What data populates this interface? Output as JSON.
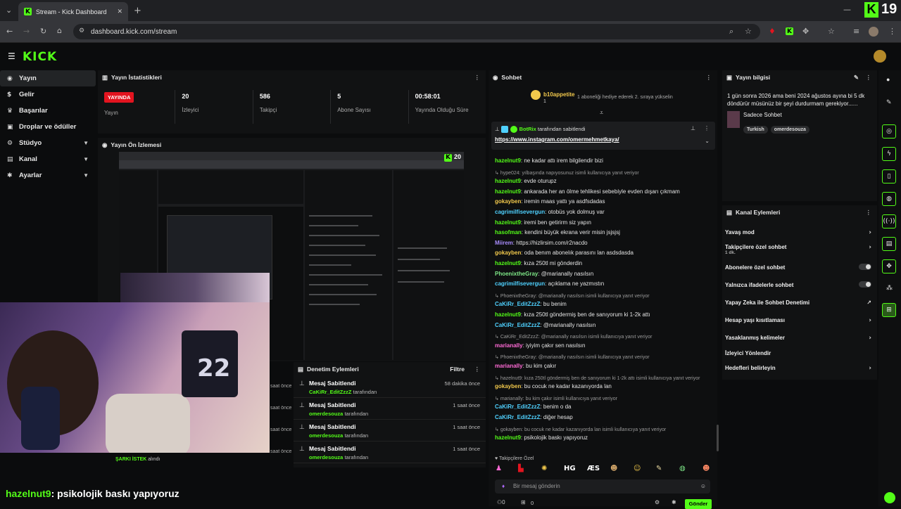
{
  "browser": {
    "tab_title": "Stream - Kick Dashboard",
    "url": "dashboard.kick.com/stream",
    "corner_number": "19"
  },
  "app": {
    "logo": "KICK"
  },
  "sidebar": {
    "items": [
      {
        "label": "Yayın",
        "icon": "broadcast-icon"
      },
      {
        "label": "Gelir",
        "icon": "dollar-icon"
      },
      {
        "label": "Başarılar",
        "icon": "trophy-icon"
      },
      {
        "label": "Droplar ve ödüller",
        "icon": "gift-icon"
      },
      {
        "label": "Stüdyo",
        "icon": "studio-icon"
      },
      {
        "label": "Kanal",
        "icon": "channel-icon"
      },
      {
        "label": "Ayarlar",
        "icon": "gear-icon"
      }
    ]
  },
  "stats": {
    "title": "Yayın İstatistikleri",
    "live_badge": "YAYINDA",
    "items": [
      {
        "value": "",
        "label": "Yayın"
      },
      {
        "value": "20",
        "label": "İzleyici"
      },
      {
        "value": "586",
        "label": "Takipçi"
      },
      {
        "value": "5",
        "label": "Abone Sayısı"
      },
      {
        "value": "00:58:01",
        "label": "Yayında Olduğu Süre"
      }
    ]
  },
  "preview": {
    "title": "Yayın Ön İzlemesi",
    "viewer_count": "20"
  },
  "overlay": {
    "subtitle_user": "hazelnut9",
    "subtitle_text": ": psikolojik baskı yapıyoruz",
    "song_request": "ŞARKI İSTEK",
    "song_request_suffix": " alındı",
    "partial_time": "saat önce"
  },
  "modlog": {
    "title": "Denetim Eylemleri",
    "filter": "Filtre",
    "items": [
      {
        "title": "Mesaj Sabitlendi",
        "user": "CaKiRr_EditZzzZ",
        "suffix": " tarafından",
        "time": "58 dakika önce"
      },
      {
        "title": "Mesaj Sabitlendi",
        "user": "omerdesouza",
        "suffix": " tarafından",
        "time": "1 saat önce"
      },
      {
        "title": "Mesaj Sabitlendi",
        "user": "omerdesouza",
        "suffix": " tarafından",
        "time": "1 saat önce"
      },
      {
        "title": "Mesaj Sabitlendi",
        "user": "omerdesouza",
        "suffix": " tarafından",
        "time": "1 saat önce"
      }
    ]
  },
  "chat": {
    "title": "Sohbet",
    "gift_user": "b10appetite",
    "gift_count": "1",
    "gift_text": "1 aboneliği hediye ederek 2. sıraya yükselin",
    "pinned_by": "BotRix",
    "pinned_suffix": " tarafından sabitlendi",
    "pinned_link": "https://www.instagram.com/omermehmetkaya/",
    "messages": [
      {
        "type": "msg",
        "user": "hazelnut9",
        "text": ": ne kadar attı irem bilgilendir bizi",
        "c": "g1"
      },
      {
        "type": "reply",
        "text": "hype024: yılbaşında napıyosunuz isimli kullanıcıya yanıt veriyor"
      },
      {
        "type": "msg",
        "user": "hazelnut9",
        "text": ": evde oturupz",
        "c": "g1"
      },
      {
        "type": "msg",
        "user": "hazelnut9",
        "text": ": ankarada her an ölme tehlikesi sebebiyle evden dışarı çıkmam",
        "c": "g1"
      },
      {
        "type": "msg",
        "user": "gokayben",
        "text": ": iremin maas yattı ya asdfsdadas",
        "c": "g3"
      },
      {
        "type": "msg",
        "user": "cagrimilfisevergun",
        "text": ": otobüs yok dolmuş var",
        "c": "g2"
      },
      {
        "type": "msg",
        "user": "hazelnut9",
        "text": ": iremi ben getirirm siz yapın",
        "c": "g1"
      },
      {
        "type": "msg",
        "user": "hasofman",
        "text": ": kendini büyük ekrana verir misin jsjsjsj",
        "c": "g1"
      },
      {
        "type": "msg",
        "user": "Miirem",
        "text": ": https://hizlirsim.com/r2nacdo",
        "c": "g6"
      },
      {
        "type": "msg",
        "user": "gokayben",
        "text": ": oda benım abonelık parasını lan asdsdasda",
        "c": "g3"
      },
      {
        "type": "msg",
        "user": "hazelnut9",
        "text": ": kıza 250tl mi gönderdin",
        "c": "g1"
      },
      {
        "type": "msg",
        "user": "PhoenixtheGray",
        "text": ": @marianally nasılsın",
        "c": "g5"
      },
      {
        "type": "msg",
        "user": "cagrimilfisevergun",
        "text": ": açıklama ne yazmıstın",
        "c": "g2"
      },
      {
        "type": "reply",
        "text": "PhoenixtheGray: @marianally nasılsın isimli kullanıcıya yanıt veriyor"
      },
      {
        "type": "msg",
        "user": "CaKiRr_EditZzzZ",
        "text": ": bu benim",
        "c": "g2"
      },
      {
        "type": "msg",
        "user": "hazelnut9",
        "text": ": kıza 250tl göndermiş ben de sanıyorum ki 1-2k attı",
        "c": "g1"
      },
      {
        "type": "msg",
        "user": "CaKiRr_EditZzzZ",
        "text": ": @marianally nasılsın",
        "c": "g2"
      },
      {
        "type": "reply",
        "text": "CaKiRr_EditZzzZ: @marianally nasılsın isimli kullanıcıya yanıt veriyor"
      },
      {
        "type": "msg",
        "user": "marianally",
        "text": ": iyiyim çakır sen nasılsın",
        "c": "g4"
      },
      {
        "type": "reply",
        "text": "PhoenixtheGray: @marianally nasılsın isimli kullanıcıya yanıt veriyor"
      },
      {
        "type": "msg",
        "user": "marianally",
        "text": ": bu kim çakır",
        "c": "g4"
      },
      {
        "type": "reply",
        "text": "hazelnut9: kıza 250tl göndermiş ben de sanıyorum ki 1-2k attı isimli kullanıcıya yanıt veriyor"
      },
      {
        "type": "msg",
        "user": "gokayben",
        "text": ": bu cocuk ne kadar kazanıyorda lan",
        "c": "g3"
      },
      {
        "type": "reply",
        "text": "marianally: bu kim çakır isimli kullanıcıya yanıt veriyor"
      },
      {
        "type": "msg",
        "user": "CaKiRr_EditZzzZ",
        "text": ": benim o da",
        "c": "g2"
      },
      {
        "type": "msg",
        "user": "CaKiRr_EditZzzZ",
        "text": ": diğer hesap",
        "c": "g2"
      },
      {
        "type": "reply",
        "text": "gokayben: bu cocuk ne kadar kazanıyorda lan isimli kullanıcıya yanıt veriyor"
      },
      {
        "type": "msg",
        "user": "hazelnut9",
        "text": ": psikolojik baskı yapıyoruz",
        "c": "g1"
      }
    ],
    "followers_only": "Takipçilere Özel",
    "input_placeholder": "Bir mesaj gönderin",
    "send": "Gönder",
    "footer_count": "0"
  },
  "stream_info": {
    "title": "Yayın bilgisi",
    "stream_title": "1 gün sonra 2026 ama beni 2024 ağustos ayına bi 5 dk döndürür müsünüz bir şeyi durdurmam gerekiyor......",
    "category": "Sadece Sohbet",
    "tags": [
      "Turkish",
      "omerdesouza"
    ]
  },
  "channel_actions": {
    "title": "Kanal Eylemleri",
    "items": [
      {
        "label": "Yavaş mod",
        "control": "chevron"
      },
      {
        "label": "Takipçilere özel sohbet",
        "sub": "1 dk.",
        "control": "chevron"
      },
      {
        "label": "Abonelere özel sohbet",
        "control": "toggle"
      },
      {
        "label": "Yalnızca ifadelerle sohbet",
        "control": "toggle"
      },
      {
        "label": "Yapay Zeka ile Sohbet Denetimi",
        "control": "external"
      },
      {
        "label": "Hesap yaşı kısıtlaması",
        "control": "chevron"
      },
      {
        "label": "Yasaklanmış kelimeler",
        "control": "chevron"
      },
      {
        "label": "İzleyici Yönlendir",
        "control": "none"
      },
      {
        "label": "Hedefleri belirleyin",
        "control": "chevron"
      }
    ]
  },
  "colors": {
    "accent": "#53fc18",
    "live": "#e3141f",
    "bg": "#0b0c0d",
    "panel": "#111213"
  }
}
